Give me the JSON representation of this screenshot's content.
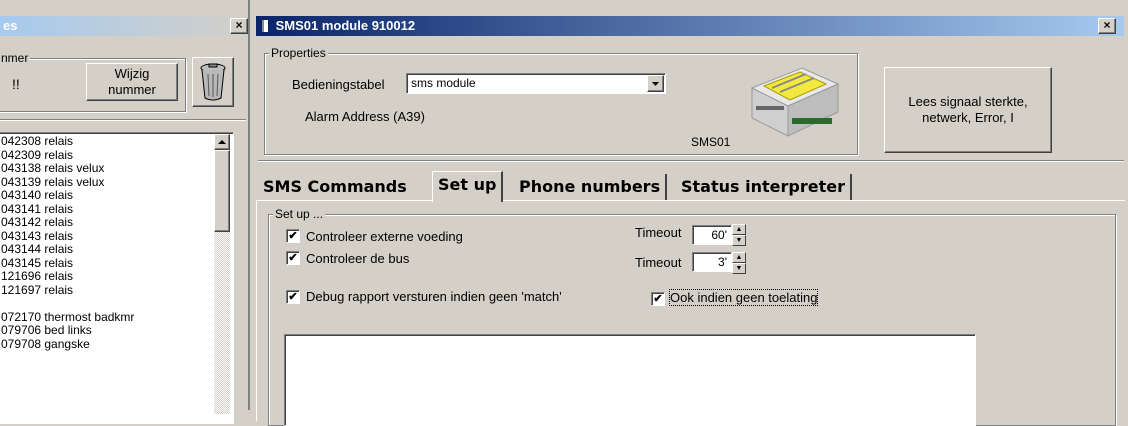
{
  "left_window": {
    "title": "es",
    "close_label": "×",
    "group_label": "nmer",
    "exclaim_text": "!!",
    "wijzig_line1": "Wijzig",
    "wijzig_line2": "nummer",
    "list_items": [
      "042308 relais",
      "042309 relais",
      "043138 relais velux",
      "043139 relais velux",
      "043140 relais",
      "043141 relais",
      "043142 relais",
      "043143 relais",
      "043144 relais",
      "043145 relais",
      "121696 relais",
      "121697 relais",
      "",
      "072170 thermost badkmr",
      "079706 bed links",
      "079708 gangske"
    ]
  },
  "main_window": {
    "title": "SMS01 module 910012",
    "close_label": "×",
    "properties": {
      "legend": "Properties",
      "bedieningstabel_label": "Bedieningstabel",
      "bedieningstabel_value": "sms module",
      "alarm_address": "Alarm Address (A39)",
      "device_label": "SMS01",
      "read_button_line1": "Lees signaal sterkte,",
      "read_button_line2": "netwerk, Error, I"
    },
    "tabs": [
      "SMS Commands",
      "Set up",
      "Phone numbers",
      "Status interpreter"
    ],
    "active_tab": "Set up",
    "setup": {
      "legend": "Set up ...",
      "options": [
        {
          "label": "Controleer externe voeding",
          "checked": true
        },
        {
          "label": "Controleer de bus",
          "checked": true
        },
        {
          "label": "Debug rapport versturen indien geen 'match'",
          "checked": true
        }
      ],
      "timeout_label": "Timeout",
      "timeout1_value": "60'",
      "timeout2_value": "3'",
      "extra_option": {
        "label": "Ook indien geen toelating",
        "checked": true
      }
    }
  }
}
